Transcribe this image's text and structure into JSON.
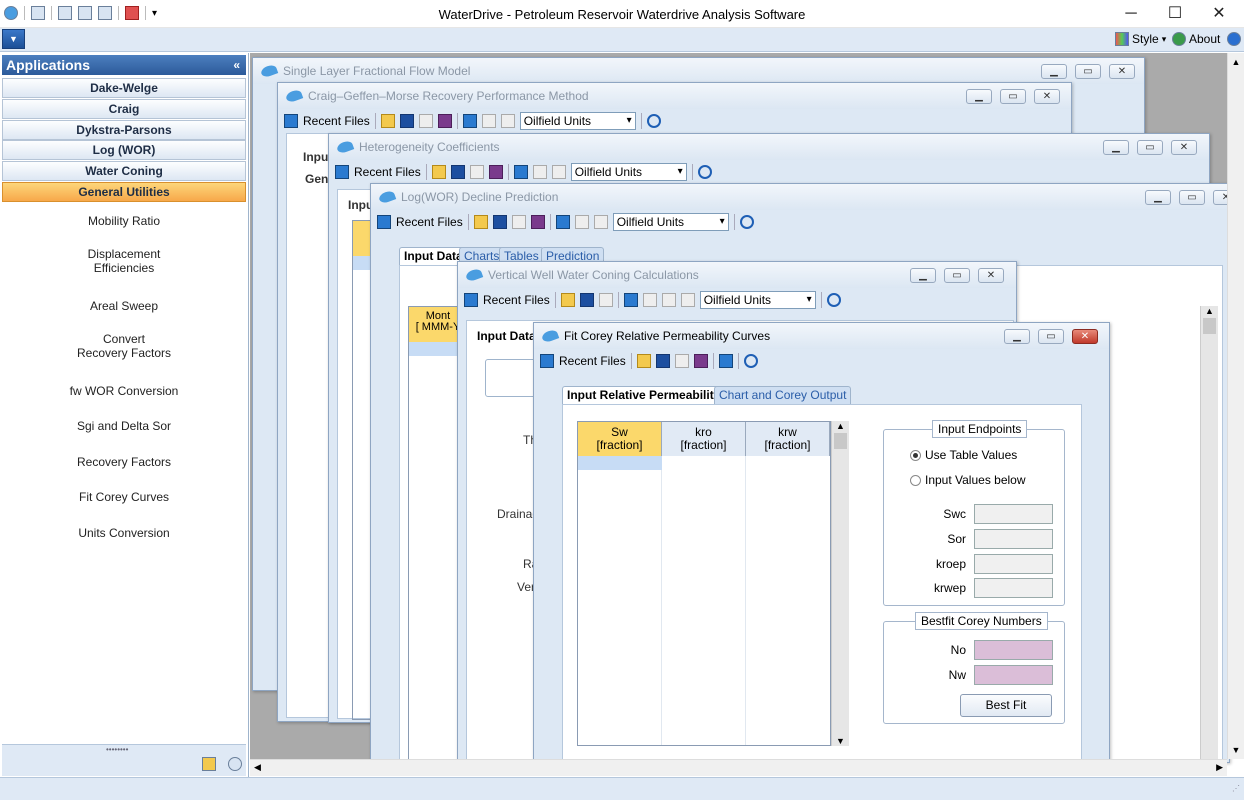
{
  "app": {
    "title": "WaterDrive - Petroleum Reservoir Waterdrive Analysis Software",
    "style_label": "Style",
    "about_label": "About"
  },
  "window_controls": {
    "minimize": "─",
    "maximize": "☐",
    "close": "✕"
  },
  "panel": {
    "title": "Applications",
    "collapse_glyph": "«",
    "nav": [
      "Dake-Welge",
      "Craig",
      "Dykstra-Parsons",
      "Log (WOR)",
      "Water Coning",
      "General Utilities"
    ],
    "utilities": [
      "Mobility Ratio",
      "Displacement\nEfficiencies",
      "Areal Sweep",
      "Convert\nRecovery Factors",
      "fw WOR Conversion",
      "Sgi and Delta Sor",
      "Recovery Factors",
      "Fit Corey Curves",
      "Units Conversion"
    ]
  },
  "toolbar": {
    "recent_files": "Recent Files",
    "units": "Oilfield Units"
  },
  "windows": {
    "w1": "Single Layer Fractional Flow Model",
    "w2": "Craig–Geffen–Morse Recovery Performance Method",
    "w3": "Heterogeneity Coefficients",
    "w4": "Log(WOR) Decline Prediction",
    "w5": "Vertical Well Water Coning Calculations",
    "w6": "Fit Corey Relative Permeability Curves"
  },
  "partial": {
    "w2_input": "Inpu",
    "w2_gen": "Gen",
    "w3_input": "Inpu",
    "w4_tabs": [
      "Input Data",
      "Charts",
      "Tables",
      "Prediction"
    ],
    "w4_month": "Mont\n[ MMM-Y",
    "w5_input": "Input Data",
    "w5_labels": [
      "Th",
      "Drainag",
      "Ra",
      "Ver"
    ]
  },
  "corey": {
    "tabs": [
      "Input Relative Permeabilities",
      "Chart and Corey Output"
    ],
    "columns": [
      {
        "name": "Sw",
        "unit": "[fraction]"
      },
      {
        "name": "kro",
        "unit": "[fraction]"
      },
      {
        "name": "krw",
        "unit": "[fraction]"
      }
    ],
    "endpoints_title": "Input Endpoints",
    "radio_table": "Use Table Values",
    "radio_below": "Input Values below",
    "fields": [
      "Swc",
      "Sor",
      "kroep",
      "krwep"
    ],
    "bestfit_title": "Bestfit Corey Numbers",
    "bestfit_fields": [
      "No",
      "Nw"
    ],
    "bestfit_button": "Best Fit"
  },
  "colors": {
    "accent": "#2c5a9a",
    "active_nav": "#f7a84a",
    "pink_field": "#dbbed8",
    "yellow_header": "#fbd86b"
  }
}
